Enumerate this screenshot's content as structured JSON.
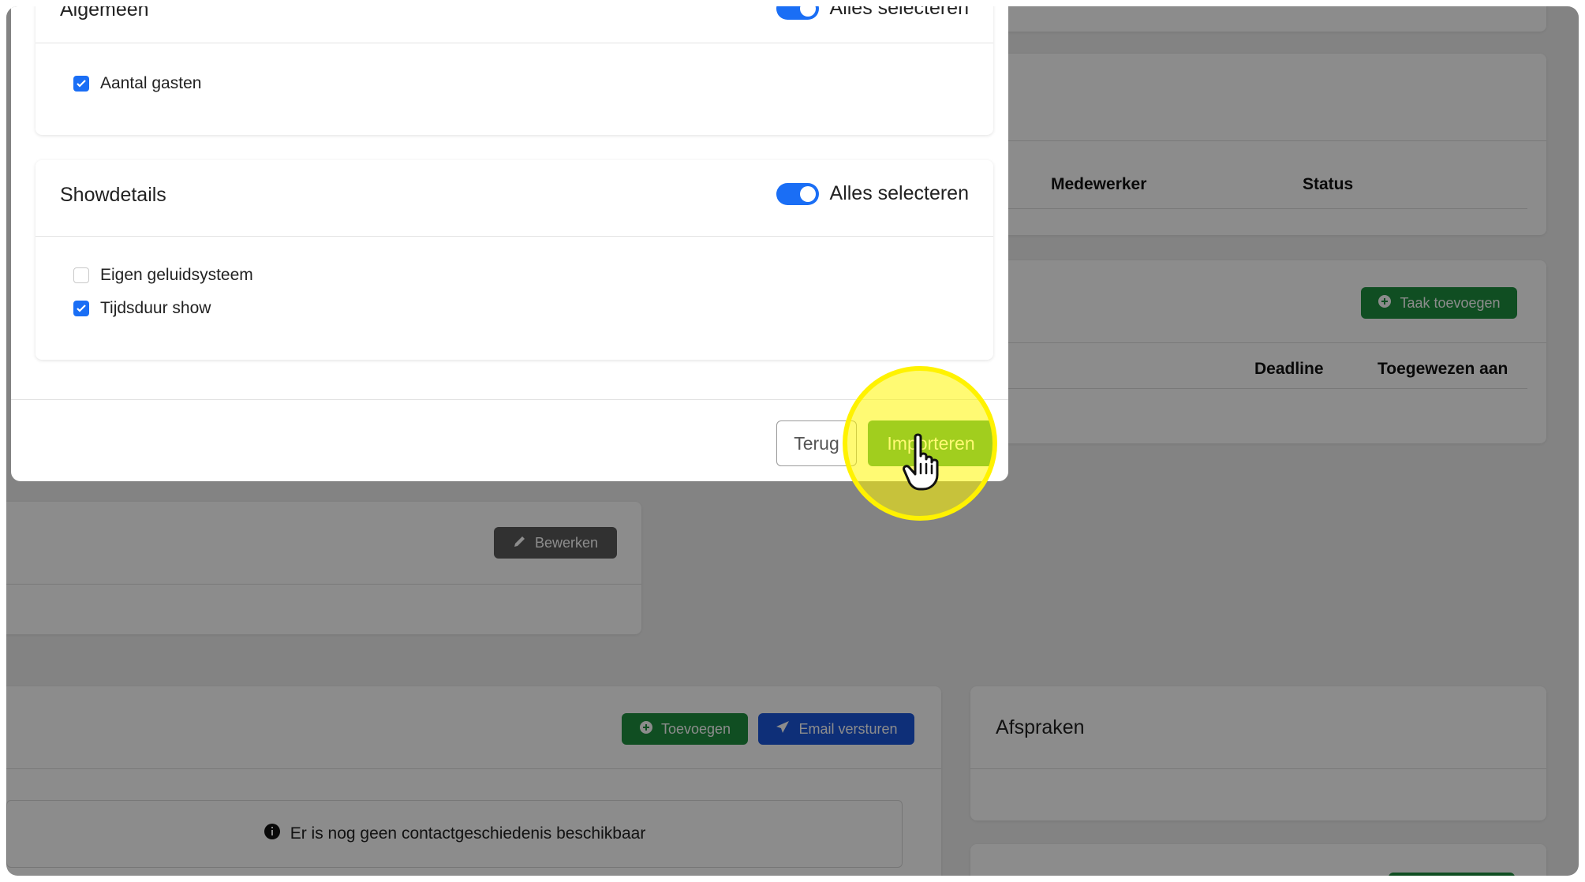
{
  "modal": {
    "section_general": {
      "title": "Algemeen",
      "toggle_label": "Alles selecteren",
      "items": [
        {
          "label": "Aantal gasten",
          "checked": true
        }
      ]
    },
    "section_show": {
      "title": "Showdetails",
      "toggle_label": "Alles selecteren",
      "items": [
        {
          "label": "Eigen geluidsysteem",
          "checked": false
        },
        {
          "label": "Tijdsduur show",
          "checked": true
        }
      ]
    },
    "back_label": "Terug",
    "import_label": "Importeren"
  },
  "background": {
    "staff_table": {
      "col_employee": "Medewerker",
      "col_status": "Status"
    },
    "tasks": {
      "add_task_label": "Taak toevoegen",
      "col_deadline": "Deadline",
      "col_assigned": "Toegewezen aan"
    },
    "edit_label": "Bewerken",
    "contact": {
      "add_label": "Toevoegen",
      "email_label": "Email versturen",
      "empty_message": "Er is nog geen contactgeschiedenis beschikbaar"
    },
    "appointments_title": "Afspraken"
  },
  "colors": {
    "accent_blue": "#1a6ef5",
    "button_green": "#2f9e44",
    "highlight": "#fff200"
  },
  "icons": {
    "plus": "plus-circle-icon",
    "send": "paper-plane-icon",
    "edit": "pencil-icon",
    "info": "info-icon",
    "cursor": "hand-pointer-icon"
  }
}
